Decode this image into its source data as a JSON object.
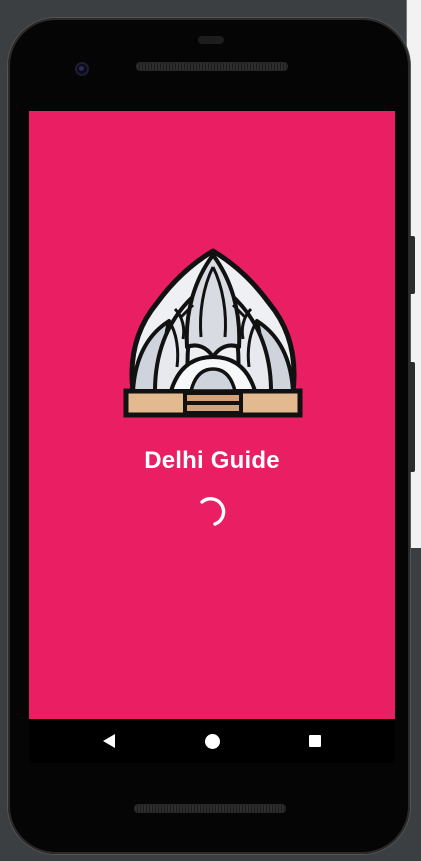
{
  "app": {
    "title": "Delhi Guide"
  },
  "splash": {
    "logo_icon": "lotus-temple-icon",
    "loading_indicator": "progress-spinner"
  },
  "navigation_bar": {
    "back_icon": "back-triangle-icon",
    "home_icon": "home-circle-icon",
    "recents_icon": "recents-square-icon"
  },
  "colors": {
    "accent": "#e91e63",
    "text": "#ffffff",
    "device_frame": "#050505",
    "navbar": "#000000"
  }
}
